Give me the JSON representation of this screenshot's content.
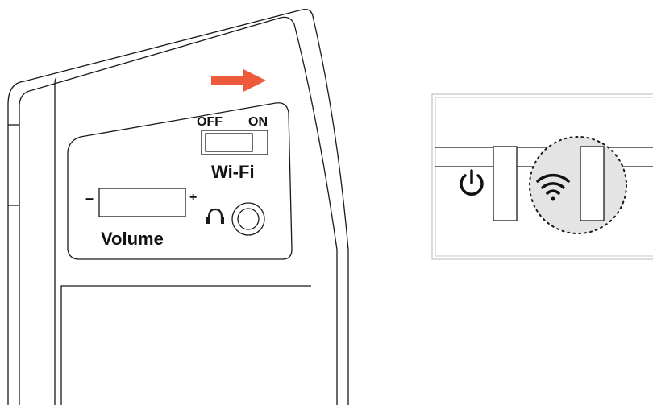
{
  "device": {
    "wifi_switch": {
      "off_label": "OFF",
      "on_label": "ON",
      "title": "Wi-Fi",
      "state": "off",
      "direction_hint": "slide toward ON"
    },
    "volume": {
      "minus_label": "–",
      "plus_label": "+",
      "title": "Volume"
    },
    "headphone_jack_icon": "headphone-icon"
  },
  "detail_panel": {
    "icons": [
      "power-icon",
      "wifi-icon"
    ],
    "highlighted": "wifi-icon"
  },
  "colors": {
    "arrow": "#ee5a3c",
    "line": "#1a1a1a",
    "highlight": "#e4e4e4"
  }
}
